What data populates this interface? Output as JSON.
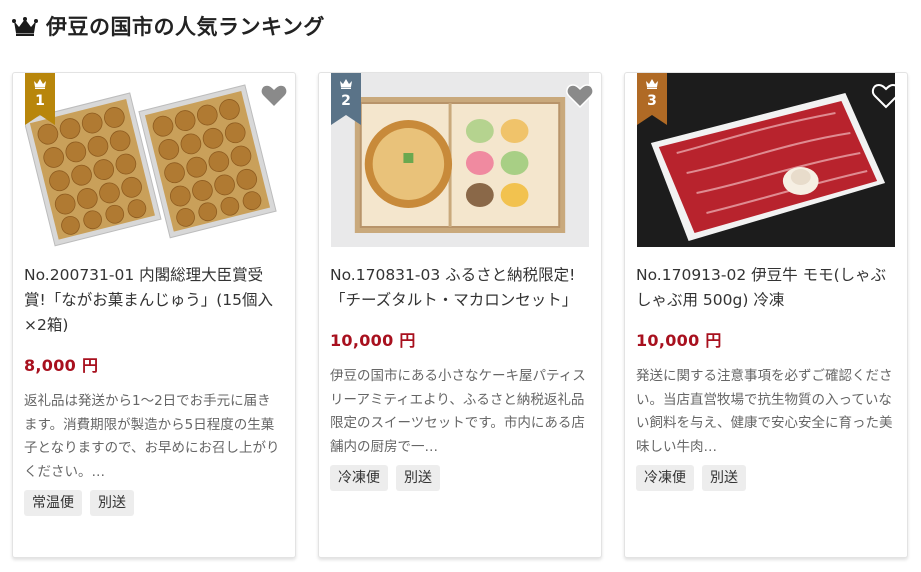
{
  "section": {
    "title": "伊豆の国市の人気ランキング",
    "icon": "crown-icon"
  },
  "colors": {
    "price": "#a8101e",
    "rank1": "#b8860b",
    "rank2": "#5a7388",
    "rank3": "#b06a25",
    "tag_bg": "#ededed"
  },
  "cards": [
    {
      "rank": "1",
      "title": "No.200731-01 内閣総理大臣賞受賞!「ながお菓まんじゅう」(15個入×2箱)",
      "price": "8,000 円",
      "description": "返礼品は発送から1〜2日でお手元に届きます。消費期限が製造から5日程度の生菓子となりますので、お早めにお召し上がりください。…",
      "tags": [
        "常温便",
        "別送"
      ],
      "favorite_icon": "heart-icon",
      "image_subject": "manju-boxes"
    },
    {
      "rank": "2",
      "title": "No.170831-03 ふるさと納税限定!「チーズタルト・マカロンセット」",
      "price": "10,000 円",
      "description": "伊豆の国市にある小さなケーキ屋パティスリーアミティエより、ふるさと納税返礼品限定のスイーツセットです。市内にある店舗内の厨房で一…",
      "tags": [
        "冷凍便",
        "別送"
      ],
      "favorite_icon": "heart-icon",
      "image_subject": "cheese-tart-macarons"
    },
    {
      "rank": "3",
      "title": "No.170913-02 伊豆牛 モモ(しゃぶしゃぶ用 500g) 冷凍",
      "price": "10,000 円",
      "description": "発送に関する注意事項を必ずご確認ください。当店直営牧場で抗生物質の入っていない飼料を与え、健康で安心安全に育った美味しい牛肉…",
      "tags": [
        "冷凍便",
        "別送"
      ],
      "favorite_icon": "heart-outline-icon",
      "image_subject": "beef-slices"
    }
  ]
}
